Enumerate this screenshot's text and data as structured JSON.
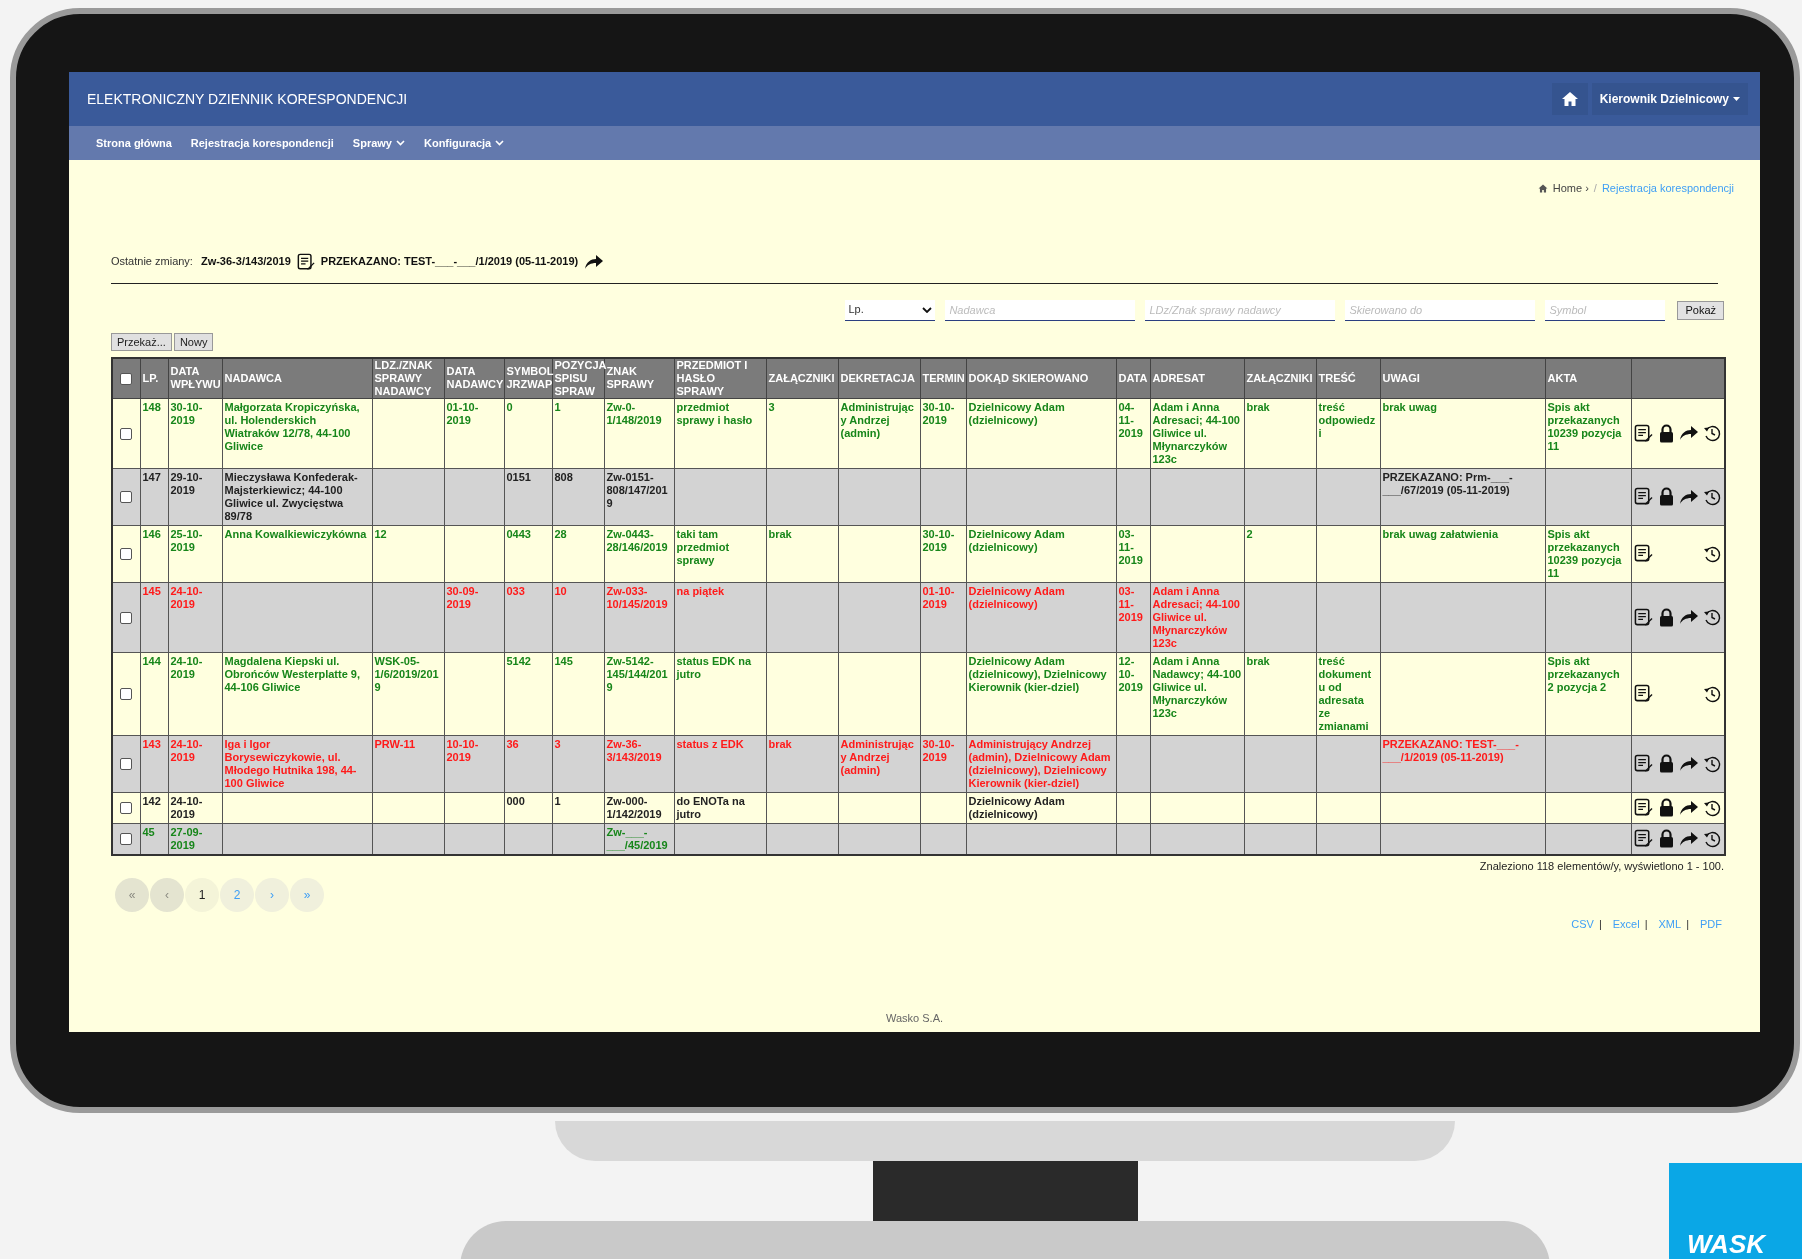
{
  "header": {
    "title": "ELEKTRONICZNY DZIENNIK KORESPONDENCJI",
    "user_menu": "Kierownik Dzielnicowy"
  },
  "nav": [
    {
      "label": "Strona główna",
      "dropdown": false
    },
    {
      "label": "Rejestracja korespondencji",
      "dropdown": false
    },
    {
      "label": "Sprawy",
      "dropdown": true
    },
    {
      "label": "Konfiguracja",
      "dropdown": true
    }
  ],
  "breadcrumb": {
    "home": "Home ›",
    "separator": "/",
    "current": "Rejestracja korespondencji"
  },
  "recent_changes": {
    "label": "Ostatnie zmiany:",
    "case": "Zw-36-3/143/2019",
    "note": "PRZEKAZANO: TEST-___-___/1/2019 (05-11-2019)"
  },
  "filters": {
    "sort": "Lp.",
    "fields": [
      {
        "placeholder": "Nadawca"
      },
      {
        "placeholder": "LDz/Znak sprawy nadawcy"
      },
      {
        "placeholder": "Skierowano do"
      },
      {
        "placeholder": "Symbol"
      }
    ],
    "button": "Pokaż"
  },
  "actions": [
    "Przekaż...",
    "Nowy"
  ],
  "table": {
    "header_checked": false,
    "columns": [
      "LP.",
      "DATA WPŁYWU",
      "NADAWCA",
      "LDZ./ZNAK SPRAWY NADAWCY",
      "DATA NADAWCY",
      "SYMBOL JRZWAP",
      "POZYCJA SPISU SPRAW",
      "ZNAK SPRAWY",
      "PRZEDMIOT I HASŁO SPRAWY",
      "ZAŁĄCZNIKI",
      "DEKRETACJA",
      "TERMIN",
      "DOKĄD SKIEROWANO",
      "DATA",
      "ADRESAT",
      "ZAŁĄCZNIKI",
      "TREŚĆ",
      "UWAGI",
      "AKTA"
    ],
    "rows": [
      {
        "color": "#17861a",
        "checked": false,
        "lock": true,
        "forward": true,
        "cells": {
          "lp": "148",
          "data_wplywu": "30-10-2019",
          "nadawca": "Małgorzata Kropiczyńska, ul. Holenderskich Wiatraków 12/78, 44-100 Gliwice",
          "data_nadawcy": "01-10-2019",
          "symbol": "0",
          "pozycja": "1",
          "znak": "Zw-0-1/148/2019",
          "przedmiot": "przedmiot sprawy i hasło",
          "zalaczniki": "3",
          "dekretacja": "Administrujący Andrzej (admin)",
          "termin": "30-10-2019",
          "dokad": "Dzielnicowy Adam (dzielnicowy)",
          "data": "04-11-2019",
          "adresat": "Adam i Anna Adresaci; 44-100 Gliwice ul. Młynarczyków 123c",
          "zalaczniki_2": "brak",
          "tresc": "treść odpowiedzi",
          "uwagi": "brak uwag",
          "akta": "Spis akt przekazanych 10239 pozycja 11"
        }
      },
      {
        "color": "#222222",
        "checked": false,
        "lock": true,
        "forward": true,
        "cells": {
          "lp": "147",
          "data_wplywu": "29-10-2019",
          "nadawca": "Mieczysława Konfederak-Majsterkiewicz; 44-100 Gliwice ul. Zwycięstwa 89/78",
          "symbol": "0151",
          "pozycja": "808",
          "znak": "Zw-0151-808/147/2019",
          "uwagi": "PRZEKAZANO: Prm-___-___/67/2019 (05-11-2019)"
        }
      },
      {
        "color": "#17861a",
        "checked": false,
        "lock": false,
        "forward": false,
        "cells": {
          "lp": "146",
          "data_wplywu": "25-10-2019",
          "nadawca": "Anna Kowalkiewiczykówna",
          "ldz": "12",
          "symbol": "0443",
          "pozycja": "28",
          "znak": "Zw-0443-28/146/2019",
          "przedmiot": "taki tam przedmiot sprawy",
          "zalaczniki": "brak",
          "termin": "30-10-2019",
          "dokad": "Dzielnicowy Adam (dzielnicowy)",
          "data": "03-11-2019",
          "zalaczniki_2": "2",
          "uwagi": "brak uwag załatwienia",
          "akta": "Spis akt przekazanych 10239 pozycja 11"
        }
      },
      {
        "color": "#ff1a1a",
        "checked": false,
        "lock": true,
        "forward": true,
        "cells": {
          "lp": "145",
          "data_wplywu": "24-10-2019",
          "data_nadawcy": "30-09-2019",
          "symbol": "033",
          "pozycja": "10",
          "znak": "Zw-033-10/145/2019",
          "przedmiot": "na piątek",
          "termin": "01-10-2019",
          "dokad": "Dzielnicowy Adam (dzielnicowy)",
          "data": "03-11-2019",
          "adresat": "Adam i Anna Adresaci; 44-100 Gliwice ul. Młynarczyków 123c"
        }
      },
      {
        "color": "#17861a",
        "checked": false,
        "lock": false,
        "forward": false,
        "cells": {
          "lp": "144",
          "data_wplywu": "24-10-2019",
          "nadawca": "Magdalena Kiepski ul. Obrońców Westerplatte 9, 44-106 Gliwice",
          "ldz": "WSK-05-1/6/2019/2019",
          "symbol": "5142",
          "pozycja": "145",
          "znak": "Zw-5142-145/144/2019",
          "przedmiot": "status EDK na jutro",
          "dokad": "Dzielnicowy Adam (dzielnicowy), Dzielnicowy Kierownik (kier-dziel)",
          "data": "12-10-2019",
          "adresat": "Adam i Anna Nadawcy; 44-100 Gliwice ul. Młynarczyków 123c",
          "zalaczniki_2": "brak",
          "tresc": "treść dokumentu od adresata ze zmianami",
          "akta": "Spis akt przekazanych 2 pozycja 2"
        }
      },
      {
        "color": "#ff1a1a",
        "checked": false,
        "lock": true,
        "forward": true,
        "cells": {
          "lp": "143",
          "data_wplywu": "24-10-2019",
          "nadawca": "Iga i Igor Borysewiczykowie, ul. Młodego Hutnika 198, 44-100 Gliwice",
          "ldz": "PRW-11",
          "data_nadawcy": "10-10-2019",
          "symbol": "36",
          "pozycja": "3",
          "znak": "Zw-36-3/143/2019",
          "przedmiot": "status z EDK",
          "zalaczniki": "brak",
          "dekretacja": "Administrujący Andrzej (admin)",
          "termin": "30-10-2019",
          "dokad": "Administrujący Andrzej (admin), Dzielnicowy Adam (dzielnicowy), Dzielnicowy Kierownik (kier-dziel)",
          "uwagi": "PRZEKAZANO: TEST-___-___/1/2019 (05-11-2019)"
        }
      },
      {
        "color": "#222222",
        "checked": false,
        "lock": true,
        "forward": true,
        "cells": {
          "lp": "142",
          "data_wplywu": "24-10-2019",
          "symbol": "000",
          "pozycja": "1",
          "znak": "Zw-000-1/142/2019",
          "przedmiot": "do ENOTa na jutro",
          "dokad": "Dzielnicowy Adam (dzielnicowy)"
        }
      },
      {
        "color": "#17861a",
        "checked": false,
        "lock": true,
        "forward": true,
        "cells": {
          "lp": "45",
          "data_wplywu": "27-09-2019",
          "znak": "Zw-___-___/45/2019"
        }
      }
    ]
  },
  "summary": "Znaleziono 118 elementów/y, wyświetlono 1 - 100.",
  "pagination": [
    {
      "label": "«",
      "disabled": true,
      "selected": false
    },
    {
      "label": "‹",
      "disabled": true,
      "selected": false
    },
    {
      "label": "1",
      "disabled": false,
      "selected": true
    },
    {
      "label": "2",
      "disabled": false,
      "selected": false
    },
    {
      "label": "›",
      "disabled": false,
      "selected": false
    },
    {
      "label": "»",
      "disabled": false,
      "selected": false
    }
  ],
  "exports": [
    "CSV",
    "Excel",
    "XML",
    "PDF"
  ],
  "export_separator": "|",
  "footer": "Wasko S.A.",
  "logo": "WASK"
}
